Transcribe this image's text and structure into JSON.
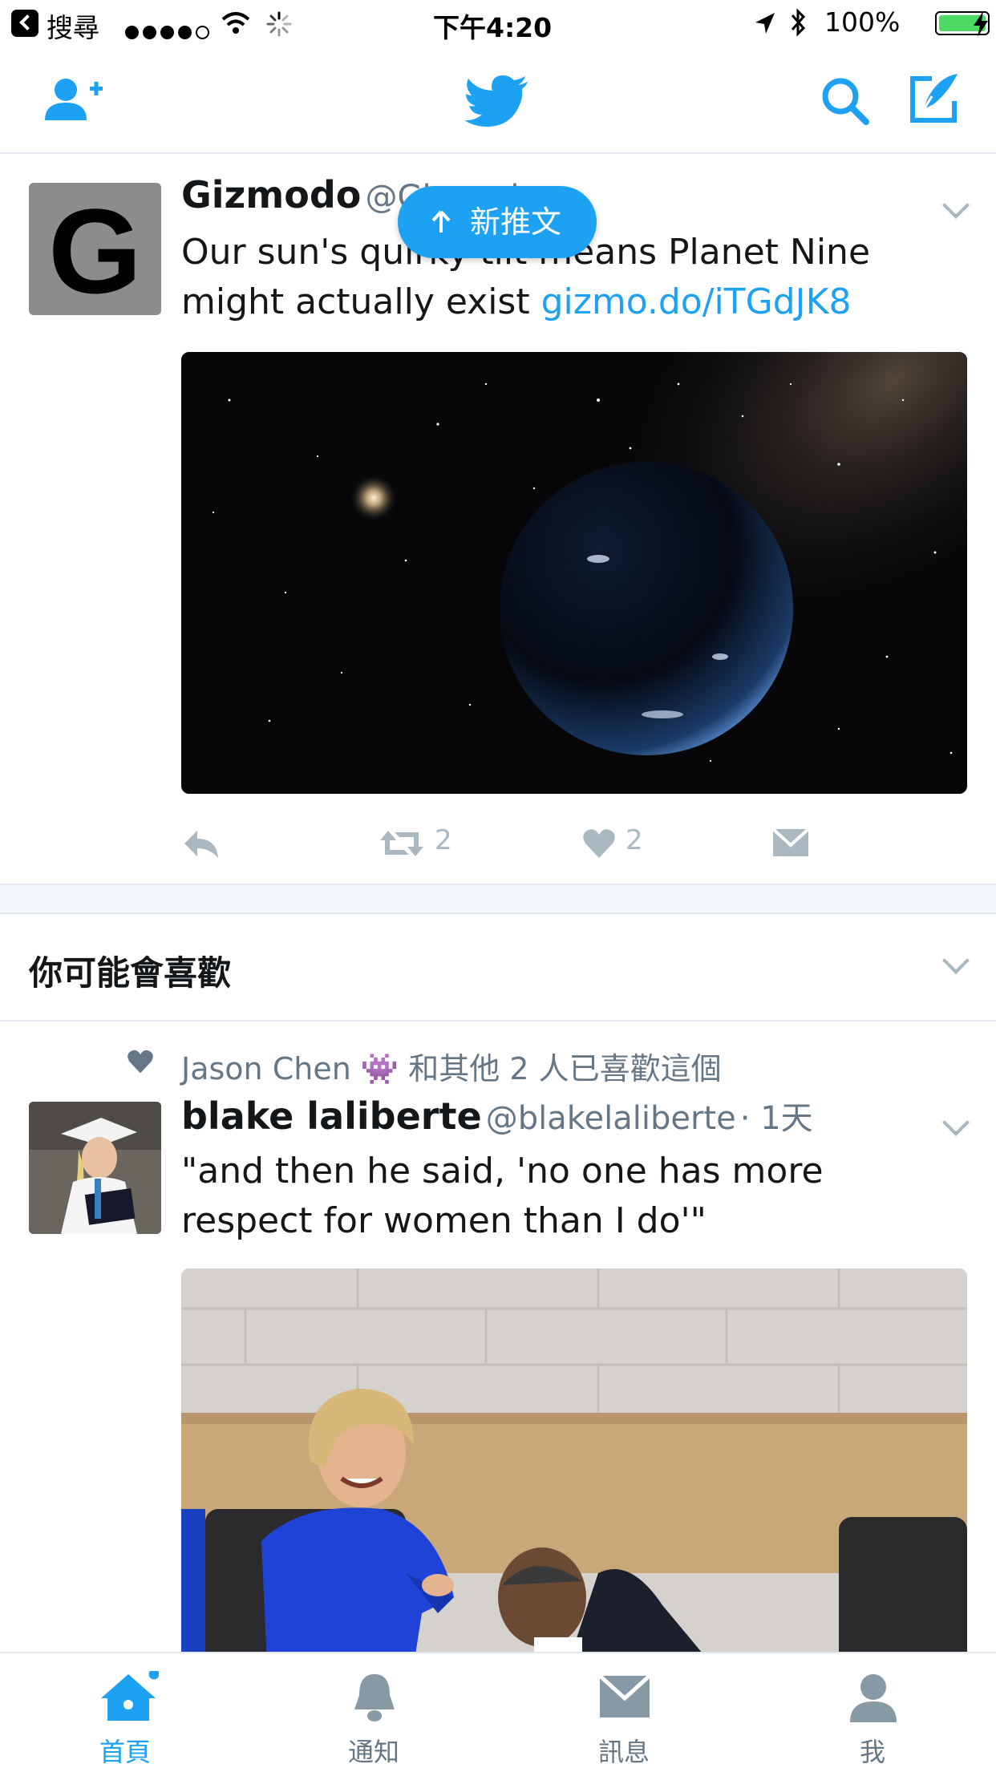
{
  "status_bar": {
    "back_label": "搜尋",
    "time": "下午4:20",
    "battery": "100%"
  },
  "new_tweets_pill": {
    "label": "新推文"
  },
  "tweets": [
    {
      "name": "Gizmodo",
      "handle": "@Gizmodo",
      "text": "Our sun's quirky tilt means Planet Nine might actually exist",
      "link": "gizmo.do/iTGdJK8",
      "retweets": "2",
      "likes": "2"
    },
    {
      "social_context": "Jason Chen 👾 和其他 2 人已喜歡這個",
      "name": "blake laliberte",
      "handle": "@blakelaliberte",
      "time": "· 1天",
      "text": "\"and then he said, 'no one has more respect for women than I do'\""
    }
  ],
  "section": {
    "title": "你可能會喜歡"
  },
  "tab_bar": {
    "home": "首頁",
    "notifications": "通知",
    "messages": "訊息",
    "me": "我"
  },
  "colors": {
    "accent": "#1da1f2",
    "border": "#e1e8ed",
    "muted": "#657786"
  }
}
